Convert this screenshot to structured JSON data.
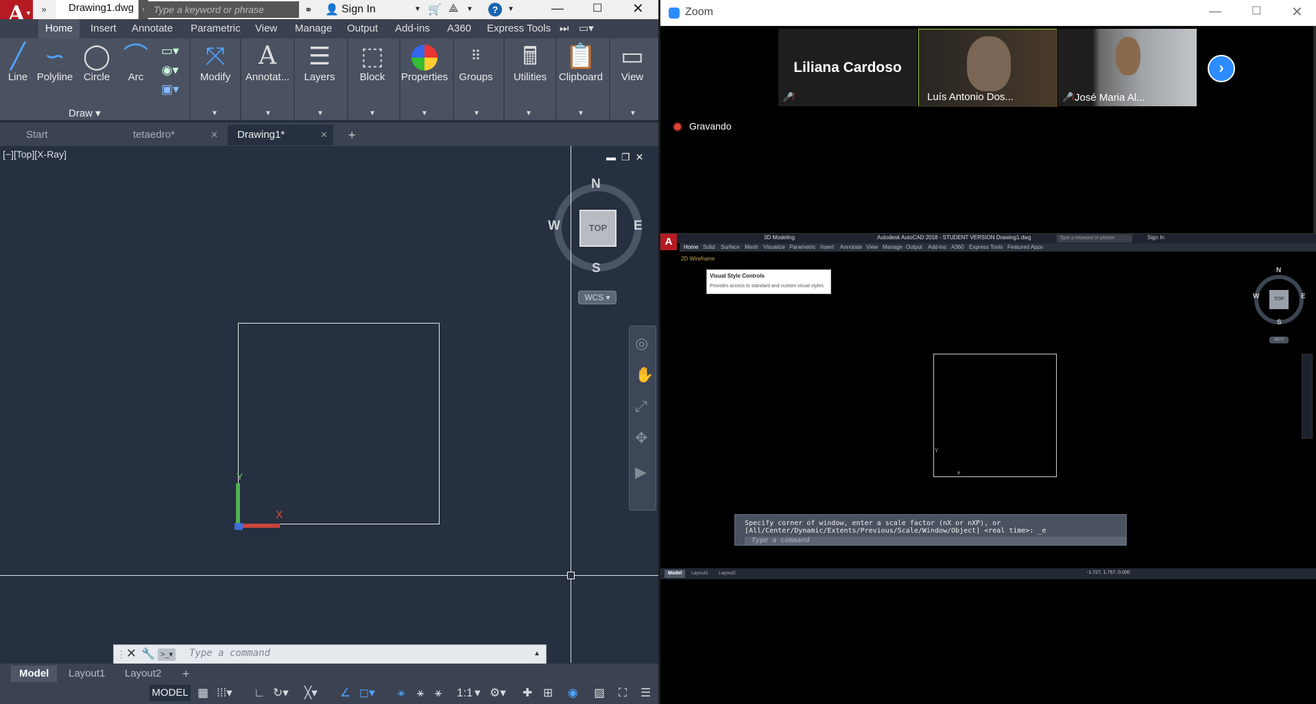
{
  "acad": {
    "logo": "A",
    "doc_title": "Drawing1.dwg",
    "search_placeholder": "Type a keyword or phrase",
    "sign_in": "Sign In",
    "ribbon_tabs": [
      "Home",
      "Insert",
      "Annotate",
      "Parametric",
      "View",
      "Manage",
      "Output",
      "Add-ins",
      "A360",
      "Express Tools"
    ],
    "active_tab": "Home",
    "tools": {
      "line": "Line",
      "polyline": "Polyline",
      "circle": "Circle",
      "arc": "Arc",
      "modify": "Modify",
      "annotation": "Annotat...",
      "layers": "Layers",
      "block": "Block",
      "properties": "Properties",
      "groups": "Groups",
      "utilities": "Utilities",
      "clipboard": "Clipboard",
      "view": "View"
    },
    "draw_panel_title": "Draw",
    "file_tabs": [
      "Start",
      "tetaedro*",
      "Drawing1*"
    ],
    "active_file_tab": "Drawing1*",
    "viewport_label": "[−][Top][X-Ray]",
    "viewcube": {
      "top": "TOP",
      "n": "N",
      "s": "S",
      "e": "E",
      "w": "W",
      "wcs": "WCS"
    },
    "ucs": {
      "x": "X",
      "y": "Y"
    },
    "command_placeholder": "Type a command",
    "layout_tabs": [
      "Model",
      "Layout1",
      "Layout2"
    ],
    "active_layout_tab": "Model",
    "status_model": "MODEL",
    "status_scale": "1:1",
    "colors": {
      "logo": "#b51b23",
      "viewport_bg": "#263040",
      "ucs_x": "#c9453c",
      "ucs_y": "#4fb04f"
    }
  },
  "zoom": {
    "window_title": "Zoom",
    "participants": [
      {
        "name": "Liliana Cardoso",
        "muted": true
      },
      {
        "name": "Luís Antonio Dos...",
        "muted": false
      },
      {
        "name": "José Maria Al...",
        "muted": true
      }
    ],
    "recording_label": "Gravando",
    "shared": {
      "app_title": "Autodesk AutoCAD 2018 - STUDENT VERSION    Drawing1.dwg",
      "workspace": "3D Modeling",
      "search_placeholder": "Type a keyword or phrase",
      "sign_in": "Sign In",
      "tabs": [
        "Home",
        "Solid",
        "Surface",
        "Mesh",
        "Visualize",
        "Parametric",
        "Insert",
        "Annotate",
        "View",
        "Manage",
        "Output",
        "Add-ins",
        "A360",
        "Express Tools",
        "Featured Apps"
      ],
      "viewport_label": "2D Wireframe",
      "tooltip_title": "Visual Style Controls",
      "tooltip_desc": "Provides access to standard and custom visual styles.",
      "viewcube": {
        "top": "TOP",
        "n": "N",
        "s": "S",
        "e": "E",
        "w": "W",
        "wcs": "WCS"
      },
      "cmd_line1": "Specify corner of window, enter a scale factor (nX or nXP), or",
      "cmd_line2": "[All/Center/Dynamic/Extents/Previous/Scale/Window/Object] <real time>: _e",
      "cmd_placeholder": "Type a command",
      "layout_tabs": [
        "Model",
        "Layout1",
        "Layout2"
      ],
      "coords": "-1.727, 1.757, 0.000"
    },
    "colors": {
      "accent": "#2d8cff",
      "recording": "#e0403a",
      "active_speaker": "#9ad044"
    }
  }
}
